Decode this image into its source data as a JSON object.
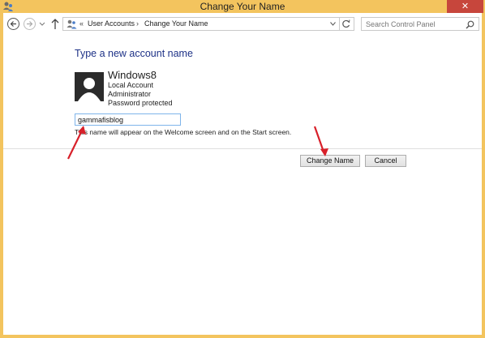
{
  "window": {
    "title": "Change Your Name",
    "close_label": "✕"
  },
  "navigation": {
    "breadcrumb_separator": "«",
    "breadcrumb": [
      "User Accounts",
      "Change Your Name"
    ],
    "crumb_arrow": "›",
    "search_placeholder": "Search Control Panel"
  },
  "content": {
    "heading": "Type a new account name",
    "account": {
      "name": "Windows8",
      "details": [
        "Local Account",
        "Administrator",
        "Password protected"
      ]
    },
    "new_name_value": "gammafisblog",
    "hint": "This name will appear on the Welcome screen and on the Start screen.",
    "buttons": {
      "change_name": "Change Name",
      "cancel": "Cancel"
    }
  },
  "colors": {
    "title_bar": "#f3c45e",
    "heading": "#1e3287",
    "annotation_arrow": "#d8202a"
  }
}
